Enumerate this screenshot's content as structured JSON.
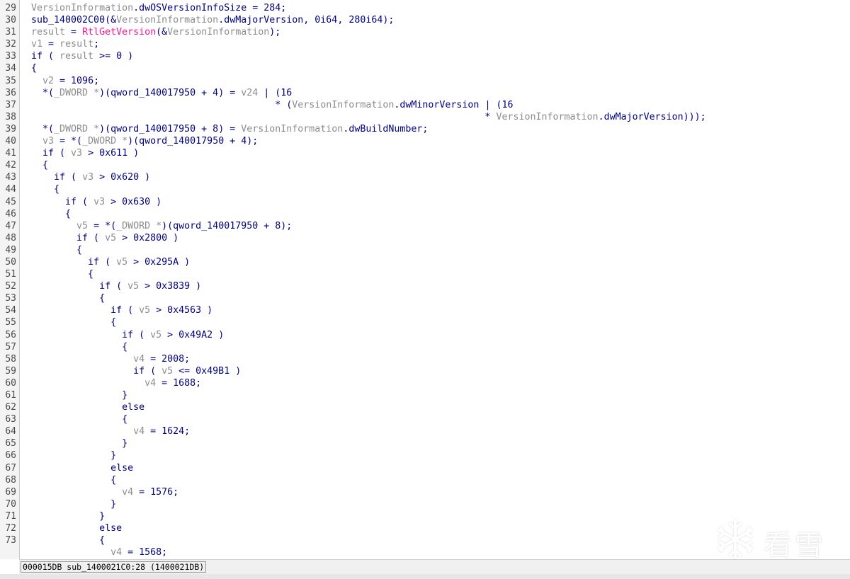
{
  "code": {
    "lines": [
      {
        "n": "29",
        "parts": [
          [
            "v",
            "VersionInformation"
          ],
          [
            "n",
            ".dwOSVersionInfoSize = 284;"
          ]
        ]
      },
      {
        "n": "30",
        "parts": [
          [
            "n",
            "sub_140002C00(&"
          ],
          [
            "v",
            "VersionInformation"
          ],
          [
            "n",
            ".dwMajorVersion, 0i64, 280i64);"
          ]
        ]
      },
      {
        "n": "31",
        "parts": [
          [
            "v",
            "result"
          ],
          [
            "n",
            " = "
          ],
          [
            "f",
            "RtlGetVersion"
          ],
          [
            "n",
            "(&"
          ],
          [
            "v",
            "VersionInformation"
          ],
          [
            "n",
            ");"
          ]
        ]
      },
      {
        "n": "32",
        "parts": [
          [
            "v",
            "v1"
          ],
          [
            "n",
            " = "
          ],
          [
            "v",
            "result"
          ],
          [
            "n",
            ";"
          ]
        ]
      },
      {
        "n": "33",
        "parts": [
          [
            "n",
            "if ( "
          ],
          [
            "v",
            "result"
          ],
          [
            "n",
            " >= 0 )"
          ]
        ]
      },
      {
        "n": "34",
        "parts": [
          [
            "n",
            "{"
          ]
        ]
      },
      {
        "n": "35",
        "parts": [
          [
            "n",
            "  "
          ],
          [
            "v",
            "v2"
          ],
          [
            "n",
            " = 1096;"
          ]
        ]
      },
      {
        "n": "36",
        "parts": [
          [
            "n",
            "  *("
          ],
          [
            "v",
            "_DWORD *"
          ],
          [
            "n",
            ")(qword_140017950 + 4) = "
          ],
          [
            "v",
            "v24"
          ],
          [
            "n",
            " | (16"
          ]
        ]
      },
      {
        "n": "37",
        "parts": [
          [
            "n",
            "                                           * ("
          ],
          [
            "v",
            "VersionInformation"
          ],
          [
            "n",
            ".dwMinorVersion | (16"
          ]
        ]
      },
      {
        "n": "38",
        "parts": [
          [
            "n",
            "                                                                                * "
          ],
          [
            "v",
            "VersionInformation"
          ],
          [
            "n",
            ".dwMajorVersion)));"
          ]
        ]
      },
      {
        "n": "39",
        "parts": [
          [
            "n",
            "  *("
          ],
          [
            "v",
            "_DWORD *"
          ],
          [
            "n",
            ")(qword_140017950 + 8) = "
          ],
          [
            "v",
            "VersionInformation"
          ],
          [
            "n",
            ".dwBuildNumber;"
          ]
        ]
      },
      {
        "n": "40",
        "parts": [
          [
            "n",
            "  "
          ],
          [
            "v",
            "v3"
          ],
          [
            "n",
            " = *("
          ],
          [
            "v",
            "_DWORD *"
          ],
          [
            "n",
            ")(qword_140017950 + 4);"
          ]
        ]
      },
      {
        "n": "41",
        "parts": [
          [
            "n",
            "  if ( "
          ],
          [
            "v",
            "v3"
          ],
          [
            "n",
            " > 0x611 )"
          ]
        ]
      },
      {
        "n": "42",
        "parts": [
          [
            "n",
            "  {"
          ]
        ]
      },
      {
        "n": "43",
        "parts": [
          [
            "n",
            "    if ( "
          ],
          [
            "v",
            "v3"
          ],
          [
            "n",
            " > 0x620 )"
          ]
        ]
      },
      {
        "n": "44",
        "parts": [
          [
            "n",
            "    {"
          ]
        ]
      },
      {
        "n": "45",
        "parts": [
          [
            "n",
            "      if ( "
          ],
          [
            "v",
            "v3"
          ],
          [
            "n",
            " > 0x630 )"
          ]
        ]
      },
      {
        "n": "46",
        "parts": [
          [
            "n",
            "      {"
          ]
        ]
      },
      {
        "n": "47",
        "parts": [
          [
            "n",
            "        "
          ],
          [
            "v",
            "v5"
          ],
          [
            "n",
            " = *("
          ],
          [
            "v",
            "_DWORD *"
          ],
          [
            "n",
            ")(qword_140017950 + 8);"
          ]
        ]
      },
      {
        "n": "48",
        "parts": [
          [
            "n",
            "        if ( "
          ],
          [
            "v",
            "v5"
          ],
          [
            "n",
            " > 0x2800 )"
          ]
        ]
      },
      {
        "n": "49",
        "parts": [
          [
            "n",
            "        {"
          ]
        ]
      },
      {
        "n": "50",
        "parts": [
          [
            "n",
            "          if ( "
          ],
          [
            "v",
            "v5"
          ],
          [
            "n",
            " > 0x295A )"
          ]
        ]
      },
      {
        "n": "51",
        "parts": [
          [
            "n",
            "          {"
          ]
        ]
      },
      {
        "n": "52",
        "parts": [
          [
            "n",
            "            if ( "
          ],
          [
            "v",
            "v5"
          ],
          [
            "n",
            " > 0x3839 )"
          ]
        ]
      },
      {
        "n": "53",
        "parts": [
          [
            "n",
            "            {"
          ]
        ]
      },
      {
        "n": "54",
        "parts": [
          [
            "n",
            "              if ( "
          ],
          [
            "v",
            "v5"
          ],
          [
            "n",
            " > 0x4563 )"
          ]
        ]
      },
      {
        "n": "55",
        "parts": [
          [
            "n",
            "              {"
          ]
        ]
      },
      {
        "n": "56",
        "parts": [
          [
            "n",
            "                if ( "
          ],
          [
            "v",
            "v5"
          ],
          [
            "n",
            " > 0x49A2 )"
          ]
        ]
      },
      {
        "n": "57",
        "parts": [
          [
            "n",
            "                {"
          ]
        ]
      },
      {
        "n": "58",
        "parts": [
          [
            "n",
            "                  "
          ],
          [
            "v",
            "v4"
          ],
          [
            "n",
            " = 2008;"
          ]
        ]
      },
      {
        "n": "59",
        "parts": [
          [
            "n",
            "                  if ( "
          ],
          [
            "v",
            "v5"
          ],
          [
            "n",
            " <= 0x49B1 )"
          ]
        ]
      },
      {
        "n": "60",
        "parts": [
          [
            "n",
            "                    "
          ],
          [
            "v",
            "v4"
          ],
          [
            "n",
            " = 1688;"
          ]
        ]
      },
      {
        "n": "61",
        "parts": [
          [
            "n",
            "                }"
          ]
        ]
      },
      {
        "n": "62",
        "parts": [
          [
            "n",
            "                else"
          ]
        ]
      },
      {
        "n": "63",
        "parts": [
          [
            "n",
            "                {"
          ]
        ]
      },
      {
        "n": "64",
        "parts": [
          [
            "n",
            "                  "
          ],
          [
            "v",
            "v4"
          ],
          [
            "n",
            " = 1624;"
          ]
        ]
      },
      {
        "n": "65",
        "parts": [
          [
            "n",
            "                }"
          ]
        ]
      },
      {
        "n": "66",
        "parts": [
          [
            "n",
            "              }"
          ]
        ]
      },
      {
        "n": "67",
        "parts": [
          [
            "n",
            "              else"
          ]
        ]
      },
      {
        "n": "68",
        "parts": [
          [
            "n",
            "              {"
          ]
        ]
      },
      {
        "n": "69",
        "parts": [
          [
            "n",
            "                "
          ],
          [
            "v",
            "v4"
          ],
          [
            "n",
            " = 1576;"
          ]
        ]
      },
      {
        "n": "70",
        "parts": [
          [
            "n",
            "              }"
          ]
        ]
      },
      {
        "n": "71",
        "parts": [
          [
            "n",
            "            }"
          ]
        ]
      },
      {
        "n": "72",
        "parts": [
          [
            "n",
            "            else"
          ]
        ]
      },
      {
        "n": "73",
        "parts": [
          [
            "n",
            "            {"
          ]
        ]
      },
      {
        "n": "",
        "parts": [
          [
            "n",
            "              "
          ],
          [
            "v",
            "v4"
          ],
          [
            "n",
            " = 1568;"
          ]
        ]
      }
    ]
  },
  "status": {
    "location": "000015DB sub_1400021C0:28 (1400021DB)"
  },
  "watermark": {
    "text": "看雪",
    "icon": "snowflake-icon"
  },
  "colors": {
    "code": "#000080",
    "variable": "#8c8c8c",
    "function": "#ff1493",
    "line_number": "#4a4a4a",
    "background": "#ffffff"
  }
}
